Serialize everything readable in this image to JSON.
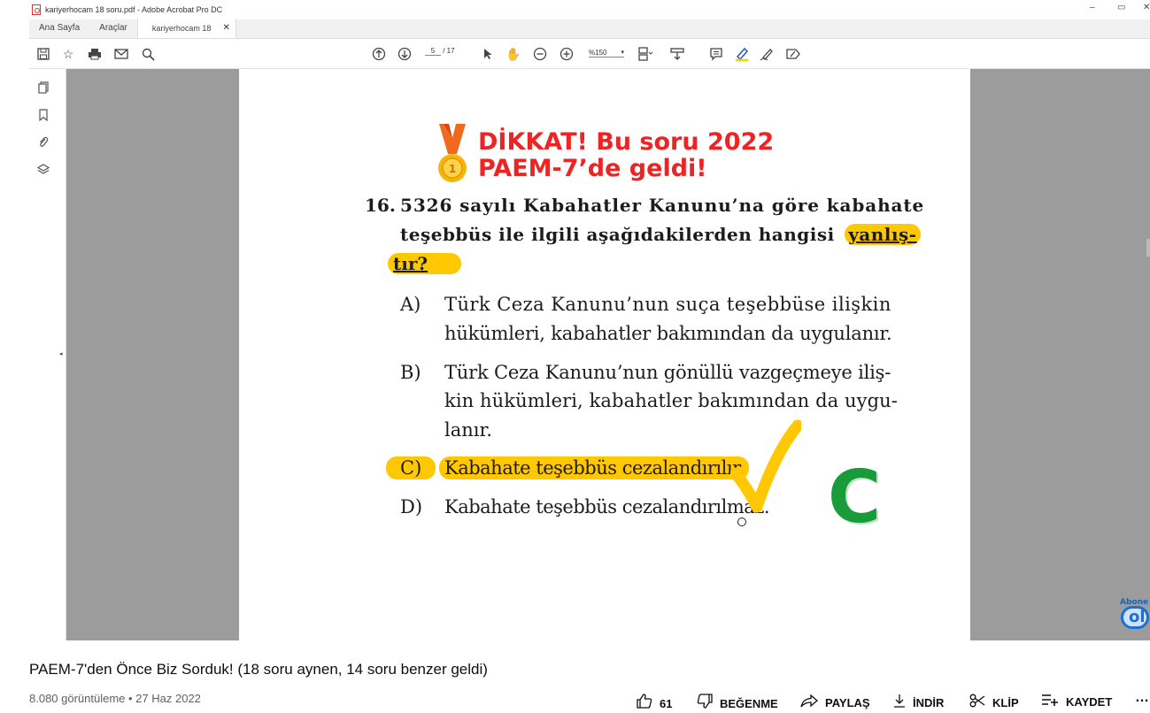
{
  "acrobat": {
    "window_title": "kariyerhocam 18 soru.pdf - Adobe Acrobat Pro DC",
    "window_controls": {
      "minimize": "–",
      "maximize": "▭",
      "close": "✕"
    },
    "tabs": [
      {
        "label": "Ana Sayfa"
      },
      {
        "label": "Araçlar"
      },
      {
        "label": "kariyerhocam 18 so...",
        "close": "✕"
      }
    ],
    "toolbar": {
      "page_current": "5",
      "page_total": "/ 17",
      "zoom": "%150"
    }
  },
  "document": {
    "banner_line1": "DİKKAT! Bu soru 2022",
    "banner_line2": "PAEM-7’de geldi!",
    "question_number": "16.",
    "question_lines": [
      "5326 sayılı Kabahatler Kanunu’na göre kabahate",
      "teşebbüs ile ilgili aşağıdakilerden hangisi",
      "yanlış-",
      "tır?"
    ],
    "options": [
      {
        "label": "A)",
        "lines": [
          "Türk Ceza Kanunu’nun suça teşebbüse ilişkin",
          "hükümleri, kabahatler bakımından da uygulanır."
        ]
      },
      {
        "label": "B)",
        "lines": [
          "Türk Ceza Kanunu’nun gönüllü vazgeçmeye iliş-",
          "kin hükümleri, kabahatler bakımından da uygu-",
          "lanır."
        ]
      },
      {
        "label": "C)",
        "lines": [
          "Kabahate teşebbüs cezalandırılır."
        ]
      },
      {
        "label": "D)",
        "lines": [
          "Kabahate teşebbüs cezalandırılmaz."
        ]
      }
    ],
    "answer_mark": "C",
    "highlight_color": "#ffc800",
    "answer_color": "#1a9b3a",
    "banner_color": "#ee2424"
  },
  "overlay": {
    "subscribe_text": "Abone",
    "subscribe_letter": "ol"
  },
  "video": {
    "title": "PAEM-7'den Önce Biz Sorduk! (18 soru aynen, 14 soru benzer geldi)",
    "meta": "8.080 görüntüleme • 27 Haz 2022",
    "actions": {
      "like_count": "61",
      "dislike": "BEĞENME",
      "share": "PAYLAŞ",
      "download": "İNDİR",
      "clip": "KLİP",
      "save": "KAYDET",
      "more": "…"
    }
  }
}
